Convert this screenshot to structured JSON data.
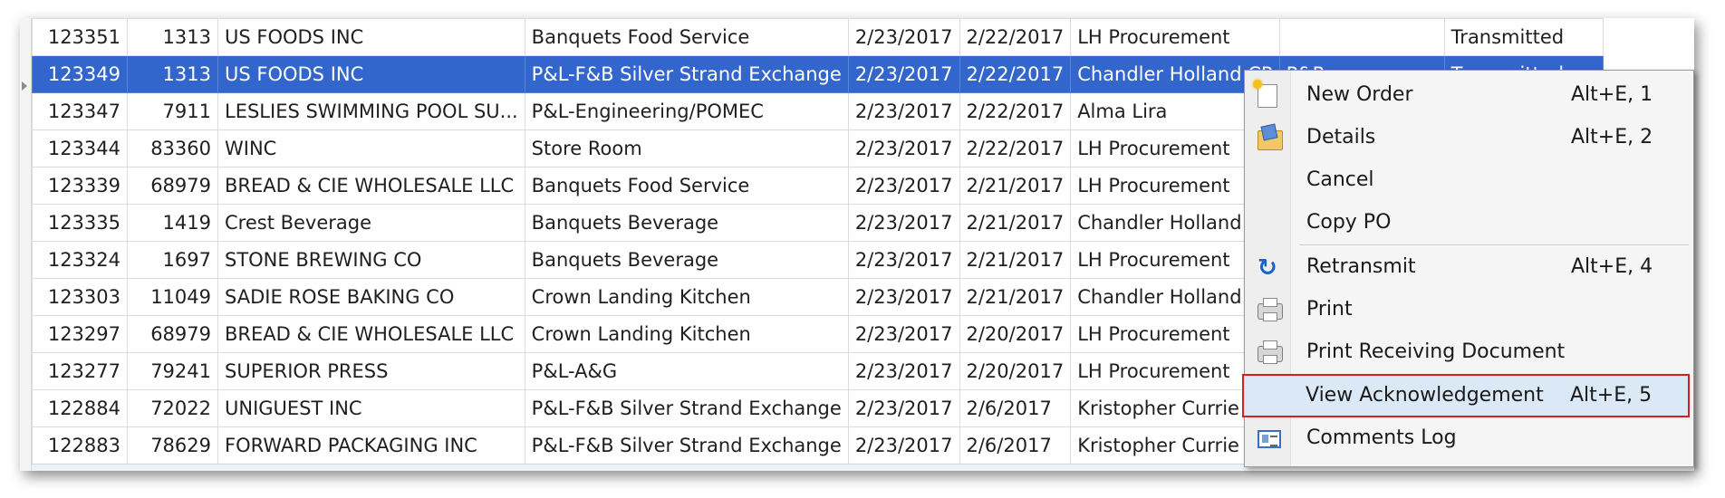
{
  "columns": [
    "po_number",
    "vendor_id",
    "vendor_name",
    "department",
    "order_date",
    "needed_date",
    "buyer",
    "extra",
    "status"
  ],
  "rows": [
    {
      "po": "123351",
      "vendor_id": "1313",
      "vendor": "US FOODS INC",
      "department": "Banquets Food Service",
      "order_date": "2/23/2017",
      "needed_date": "2/22/2017",
      "buyer": "LH Procurement",
      "extra": "",
      "status": "Transmitted"
    },
    {
      "po": "123349",
      "vendor_id": "1313",
      "vendor": "US FOODS INC",
      "department": "P&L-F&B Silver Strand Exchange",
      "order_date": "2/23/2017",
      "needed_date": "2/22/2017",
      "buyer": "Chandler Holland  CP",
      "extra": "P&P",
      "status": "Transmitted"
    },
    {
      "po": "123347",
      "vendor_id": "7911",
      "vendor": "LESLIES SWIMMING POOL SU...",
      "department": "P&L-Engineering/POMEC",
      "order_date": "2/23/2017",
      "needed_date": "2/22/2017",
      "buyer": "Alma Lira",
      "extra": "",
      "status": ""
    },
    {
      "po": "123344",
      "vendor_id": "83360",
      "vendor": "WINC",
      "department": "Store Room",
      "order_date": "2/23/2017",
      "needed_date": "2/22/2017",
      "buyer": "LH Procurement",
      "extra": "",
      "status": ""
    },
    {
      "po": "123339",
      "vendor_id": "68979",
      "vendor": "BREAD & CIE WHOLESALE LLC",
      "department": "Banquets Food Service",
      "order_date": "2/23/2017",
      "needed_date": "2/21/2017",
      "buyer": "LH Procurement",
      "extra": "",
      "status": ""
    },
    {
      "po": "123335",
      "vendor_id": "1419",
      "vendor": "Crest Beverage",
      "department": "Banquets Beverage",
      "order_date": "2/23/2017",
      "needed_date": "2/21/2017",
      "buyer": "Chandler Holland  CP",
      "extra": "",
      "status": ""
    },
    {
      "po": "123324",
      "vendor_id": "1697",
      "vendor": "STONE BREWING CO",
      "department": "Banquets Beverage",
      "order_date": "2/23/2017",
      "needed_date": "2/21/2017",
      "buyer": "LH Procurement",
      "extra": "",
      "status": ""
    },
    {
      "po": "123303",
      "vendor_id": "11049",
      "vendor": "SADIE ROSE BAKING CO",
      "department": "Crown Landing Kitchen",
      "order_date": "2/23/2017",
      "needed_date": "2/21/2017",
      "buyer": "Chandler Holland  CP",
      "extra": "",
      "status": ""
    },
    {
      "po": "123297",
      "vendor_id": "68979",
      "vendor": "BREAD & CIE WHOLESALE LLC",
      "department": "Crown Landing Kitchen",
      "order_date": "2/23/2017",
      "needed_date": "2/20/2017",
      "buyer": "LH Procurement",
      "extra": "",
      "status": ""
    },
    {
      "po": "123277",
      "vendor_id": "79241",
      "vendor": "SUPERIOR PRESS",
      "department": "P&L-A&G",
      "order_date": "2/23/2017",
      "needed_date": "2/20/2017",
      "buyer": "LH Procurement",
      "extra": "",
      "status": ""
    },
    {
      "po": "122884",
      "vendor_id": "72022",
      "vendor": "UNIGUEST INC",
      "department": "P&L-F&B Silver Strand Exchange",
      "order_date": "2/23/2017",
      "needed_date": "2/6/2017",
      "buyer": "Kristopher Currie  CP",
      "extra": "",
      "status": ""
    },
    {
      "po": "122883",
      "vendor_id": "78629",
      "vendor": "FORWARD PACKAGING INC",
      "department": "P&L-F&B Silver Strand Exchange",
      "order_date": "2/23/2017",
      "needed_date": "2/6/2017",
      "buyer": "Kristopher Currie  CP",
      "extra": "",
      "status": ""
    }
  ],
  "selected_row_po": "123349",
  "context_menu": {
    "items": [
      {
        "label": "New Order",
        "shortcut": "Alt+E, 1",
        "icon": "new-order-icon"
      },
      {
        "label": "Details",
        "shortcut": "Alt+E, 2",
        "icon": "details-folder-icon"
      },
      {
        "label": "Cancel",
        "shortcut": "",
        "icon": ""
      },
      {
        "label": "Copy PO",
        "shortcut": "",
        "icon": ""
      },
      {
        "label": "Retransmit",
        "shortcut": "Alt+E, 4",
        "icon": "retransmit-icon"
      },
      {
        "label": "Print",
        "shortcut": "",
        "icon": "print-icon"
      },
      {
        "label": "Print Receiving Document",
        "shortcut": "",
        "icon": "printer-icon"
      },
      {
        "label": "View Acknowledgement",
        "shortcut": "Alt+E, 5",
        "icon": "",
        "highlighted": true
      },
      {
        "label": "Comments Log",
        "shortcut": "",
        "icon": "comments-log-icon"
      }
    ],
    "highlight_color": "#d81e1e"
  },
  "colors": {
    "selected_row_bg": "#3366cc",
    "selected_row_text": "#ffffff",
    "grid_line": "#dcdcdc",
    "menu_bg": "#f5f5f5",
    "menu_hover": "#dbe9f7"
  }
}
